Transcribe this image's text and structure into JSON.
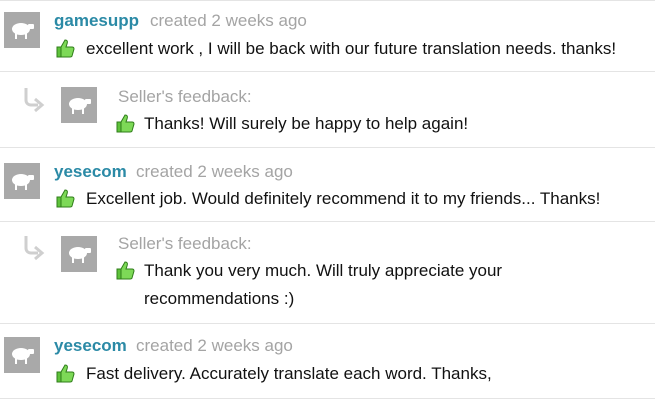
{
  "reviews": [
    {
      "user": "gamesupp",
      "created": "created 2 weeks ago",
      "text": "excellent work , I will be back with our future translation needs. thanks!",
      "seller_label": "Seller's feedback:",
      "seller_text": "Thanks! Will surely be happy to help again!"
    },
    {
      "user": "yesecom",
      "created": "created 2 weeks ago",
      "text": "Excellent job. Would definitely recommend it to my friends... Thanks!",
      "seller_label": "Seller's feedback:",
      "seller_text": "Thank you very much. Will truly appreciate your recommendations :)"
    },
    {
      "user": "yesecom",
      "created": "created 2 weeks ago",
      "text": "Fast delivery. Accurately translate each word. Thanks,"
    }
  ],
  "colors": {
    "username": "#2b8aa6",
    "meta": "#a4a4a4",
    "thumb": "#5ec23a",
    "avatar": "#a9a9a9"
  },
  "icons": {
    "avatar": "sheep-icon",
    "thumb": "thumbs-up-icon",
    "reply": "reply-arrow-icon"
  }
}
